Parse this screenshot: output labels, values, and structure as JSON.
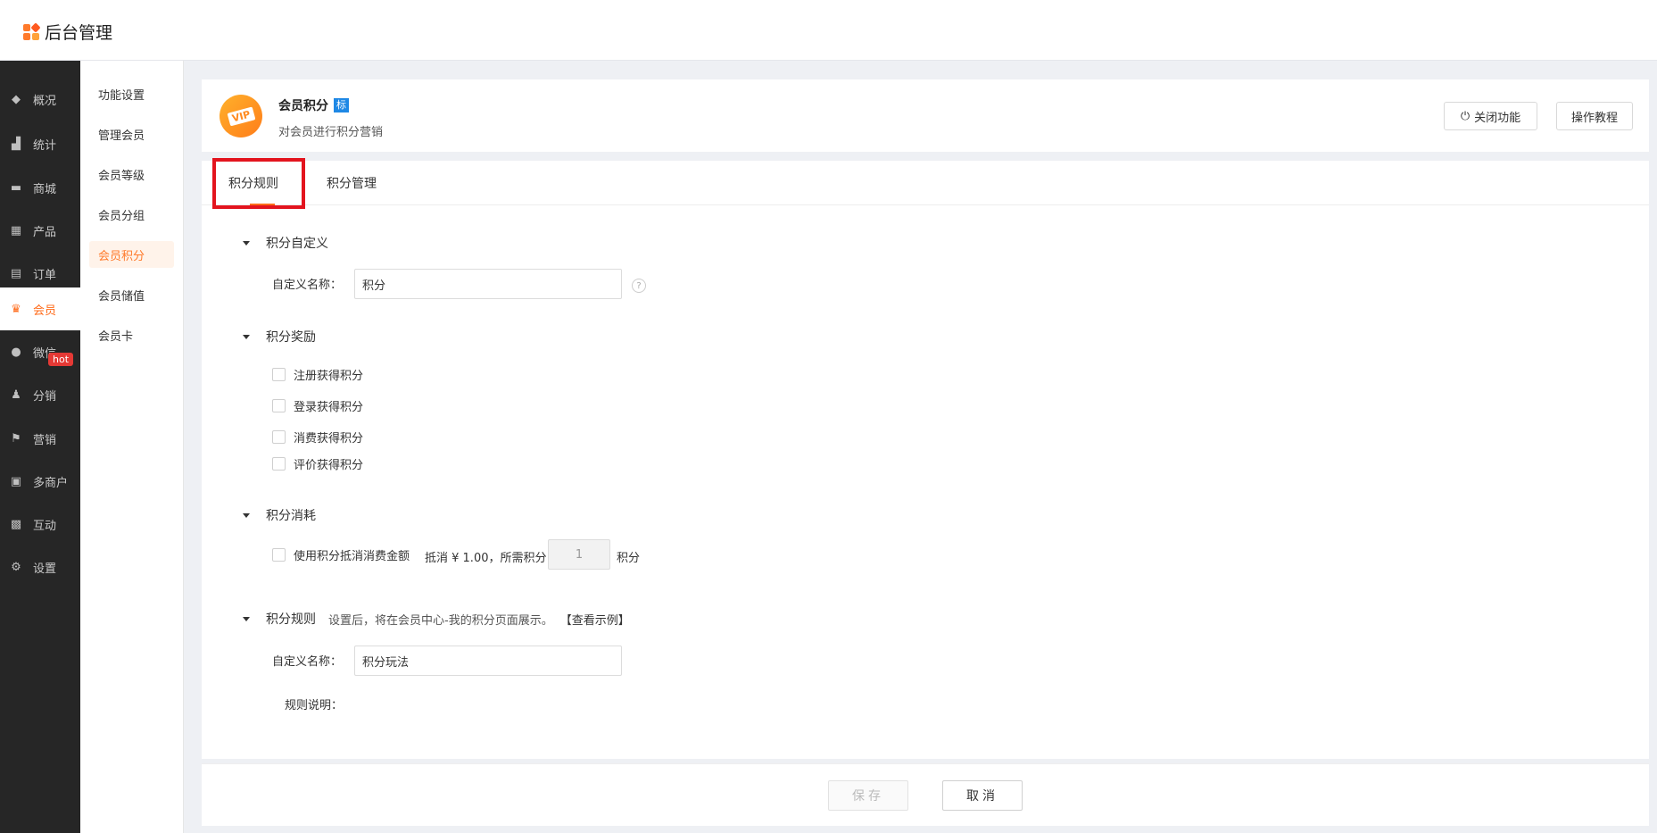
{
  "header": {
    "title": "后台管理"
  },
  "sidebar": {
    "items": [
      {
        "label": "概况",
        "icon": "layers-icon"
      },
      {
        "label": "统计",
        "icon": "chart-icon"
      },
      {
        "label": "商城",
        "icon": "shop-icon"
      },
      {
        "label": "产品",
        "icon": "grid-icon"
      },
      {
        "label": "订单",
        "icon": "order-icon"
      },
      {
        "label": "会员",
        "icon": "crown-icon",
        "active": true
      },
      {
        "label": "微信",
        "icon": "wechat-icon"
      },
      {
        "label": "分销",
        "icon": "users-icon"
      },
      {
        "label": "营销",
        "icon": "flag-icon",
        "badge": "hot"
      },
      {
        "label": "多商户",
        "icon": "store-icon"
      },
      {
        "label": "互动",
        "icon": "interact-icon"
      },
      {
        "label": "设置",
        "icon": "gear-icon"
      }
    ]
  },
  "submenu": {
    "items": [
      "功能设置",
      "管理会员",
      "会员等级",
      "会员分组",
      "会员积分",
      "会员储值",
      "会员卡"
    ],
    "active_index": 4
  },
  "plugin": {
    "title": "会员积分",
    "tag": "标",
    "description": "对会员进行积分营销",
    "icon_text": "VIP",
    "close_button": "关闭功能",
    "tutorial_button": "操作教程"
  },
  "tabs": {
    "rules": "积分规则",
    "manage": "积分管理"
  },
  "section_custom": {
    "title": "积分自定义",
    "name_label": "自定义名称：",
    "name_value": "积分",
    "help": "?"
  },
  "section_reward": {
    "title": "积分奖励",
    "options": [
      "注册获得积分",
      "登录获得积分",
      "消费获得积分",
      "评价获得积分"
    ]
  },
  "section_consume": {
    "title": "积分消耗",
    "option_label": "使用积分抵消消费金额",
    "offset_text": "抵消 ¥ 1.00，所需积分",
    "points_value": "1",
    "points_unit": "积分"
  },
  "section_rules": {
    "title": "积分规则",
    "note": "设置后，将在会员中心-我的积分页面展示。",
    "link": "【查看示例】",
    "name_label": "自定义名称：",
    "name_value": "积分玩法",
    "desc_label": "规则说明："
  },
  "footer": {
    "save": "保存",
    "cancel": "取消"
  },
  "colors": {
    "accent": "#ff6b1a",
    "highlight": "#e3141e",
    "tag_blue": "#1e88e5",
    "sidebar_bg": "#262626"
  }
}
